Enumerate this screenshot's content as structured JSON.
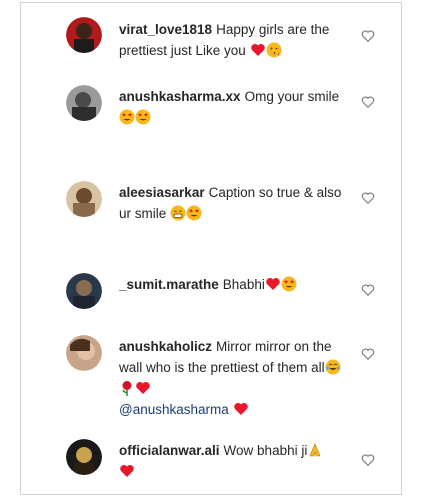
{
  "comments": [
    {
      "username": "virat_love1818",
      "text": "Happy girls are the prettiest just Like you",
      "emojis": [
        "heart",
        "kiss-face"
      ]
    },
    {
      "username": "anushkasharma.xx",
      "text": "Omg your smile",
      "emojis": [
        "heart-eyes",
        "heart-eyes"
      ]
    },
    {
      "username": "aleesiasarkar",
      "text": "Caption so true & also ur smile",
      "emojis": [
        "grin",
        "heart-eyes"
      ]
    },
    {
      "username": "_sumit.marathe",
      "text": "Bhabhi",
      "emojis": [
        "heart",
        "heart-eyes"
      ]
    },
    {
      "username": "anushkaholicz",
      "text": "Mirror mirror on the wall who is the prettiest of them all",
      "mention": "@anushkasharma",
      "emojis": [
        "cry-laugh",
        "rose",
        "heart"
      ]
    },
    {
      "username": "officialanwar.ali",
      "text": "Wow bhabhi ji",
      "emojis": [
        "pray",
        "heart"
      ]
    }
  ],
  "colors": {
    "heart": "#e8172b",
    "emoji": "#f6b91c",
    "mention": "#1b3c75"
  }
}
